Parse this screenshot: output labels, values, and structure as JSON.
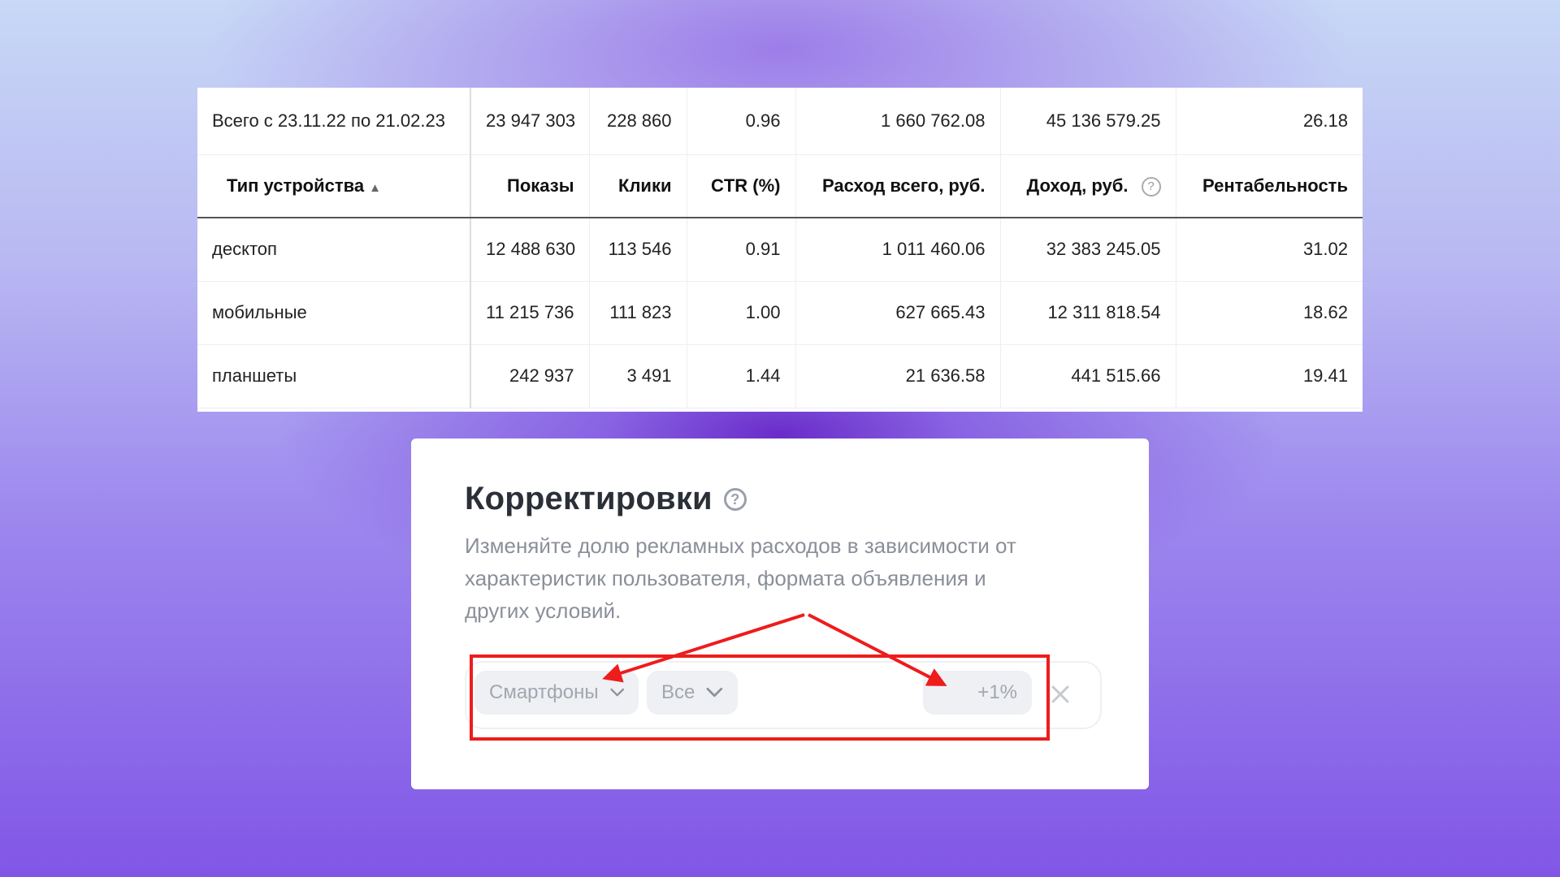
{
  "table": {
    "total": {
      "label": "Всего с 23.11.22 по 21.02.23",
      "impressions": "23 947 303",
      "clicks": "228 860",
      "ctr": "0.96",
      "spend": "1 660 762.08",
      "income": "45 136 579.25",
      "profitability": "26.18"
    },
    "headers": {
      "device": "Тип устройства",
      "sort_icon": "▲",
      "impressions": "Показы",
      "clicks": "Клики",
      "ctr": "CTR (%)",
      "spend": "Расход всего, руб.",
      "income": "Доход, руб.",
      "income_help": "?",
      "profitability": "Рентабельность"
    },
    "rows": [
      {
        "device": "десктоп",
        "impressions": "12 488 630",
        "clicks": "113 546",
        "ctr": "0.91",
        "spend": "1 011 460.06",
        "income": "32 383 245.05",
        "profitability": "31.02"
      },
      {
        "device": "мобильные",
        "impressions": "11 215 736",
        "clicks": "111 823",
        "ctr": "1.00",
        "spend": "627 665.43",
        "income": "12 311 818.54",
        "profitability": "18.62"
      },
      {
        "device": "планшеты",
        "impressions": "242 937",
        "clicks": "3 491",
        "ctr": "1.44",
        "spend": "21 636.58",
        "income": "441 515.66",
        "profitability": "19.41"
      }
    ]
  },
  "adjustments": {
    "title": "Корректировки",
    "help": "?",
    "description": "Изменяйте долю рекламных расходов в зависимости от характеристик пользователя, формата объявления и других условий.",
    "device_select": "Смартфоны",
    "filter_select": "Все",
    "percent_value": "+1%"
  },
  "icons": {
    "sort": "sort-ascending-icon",
    "help": "question-circle-icon",
    "chevron": "chevron-down-icon",
    "close": "close-icon"
  },
  "colors": {
    "annotation_red": "#ee1c1c",
    "chip_bg": "#eef0f4",
    "muted_text": "#8a8f99"
  }
}
